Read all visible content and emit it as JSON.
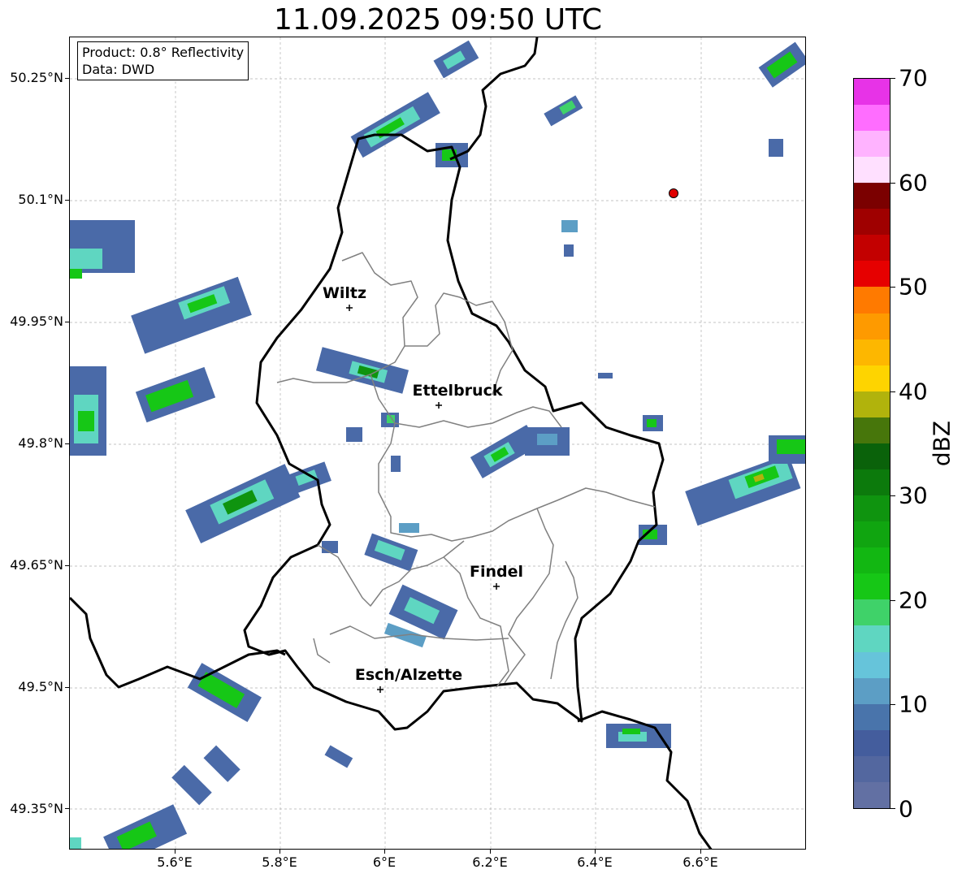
{
  "title": "11.09.2025 09:50 UTC",
  "info": {
    "product": "Product: 0.8° Reflectivity",
    "source": "Data: DWD"
  },
  "y_labels": [
    "50.25°N",
    "50.1°N",
    "49.95°N",
    "49.8°N",
    "49.65°N",
    "49.5°N",
    "49.35°N"
  ],
  "x_labels": [
    "5.6°E",
    "5.8°E",
    "6°E",
    "6.2°E",
    "6.4°E",
    "6.6°E"
  ],
  "colorbar": {
    "unit": "dBZ",
    "tick_labels": [
      "0",
      "10",
      "20",
      "30",
      "40",
      "50",
      "60",
      "70"
    ],
    "colors": [
      "#6270a3",
      "#53679f",
      "#445d9d",
      "#4974ab",
      "#5c9ec5",
      "#66c4da",
      "#5fd6c1",
      "#3fd269",
      "#16c716",
      "#12b712",
      "#10a510",
      "#0f940f",
      "#0c7a0c",
      "#0a620a",
      "#47760b",
      "#b1b30c",
      "#fed400",
      "#fdb700",
      "#fe9a00",
      "#ff7a00",
      "#e60000",
      "#c30000",
      "#9f0000",
      "#7b0000",
      "#ffe0ff",
      "#ffb3ff",
      "#ff6dff",
      "#e733e7"
    ]
  },
  "cities": [
    {
      "name": "Wiltz"
    },
    {
      "name": "Ettelbruck"
    },
    {
      "name": "Findel"
    },
    {
      "name": "Esch/Alzette"
    }
  ],
  "map_colors": {
    "border": "#000000",
    "district": "#808080",
    "grid": "#b0b0b0",
    "marker": "#e00000"
  }
}
